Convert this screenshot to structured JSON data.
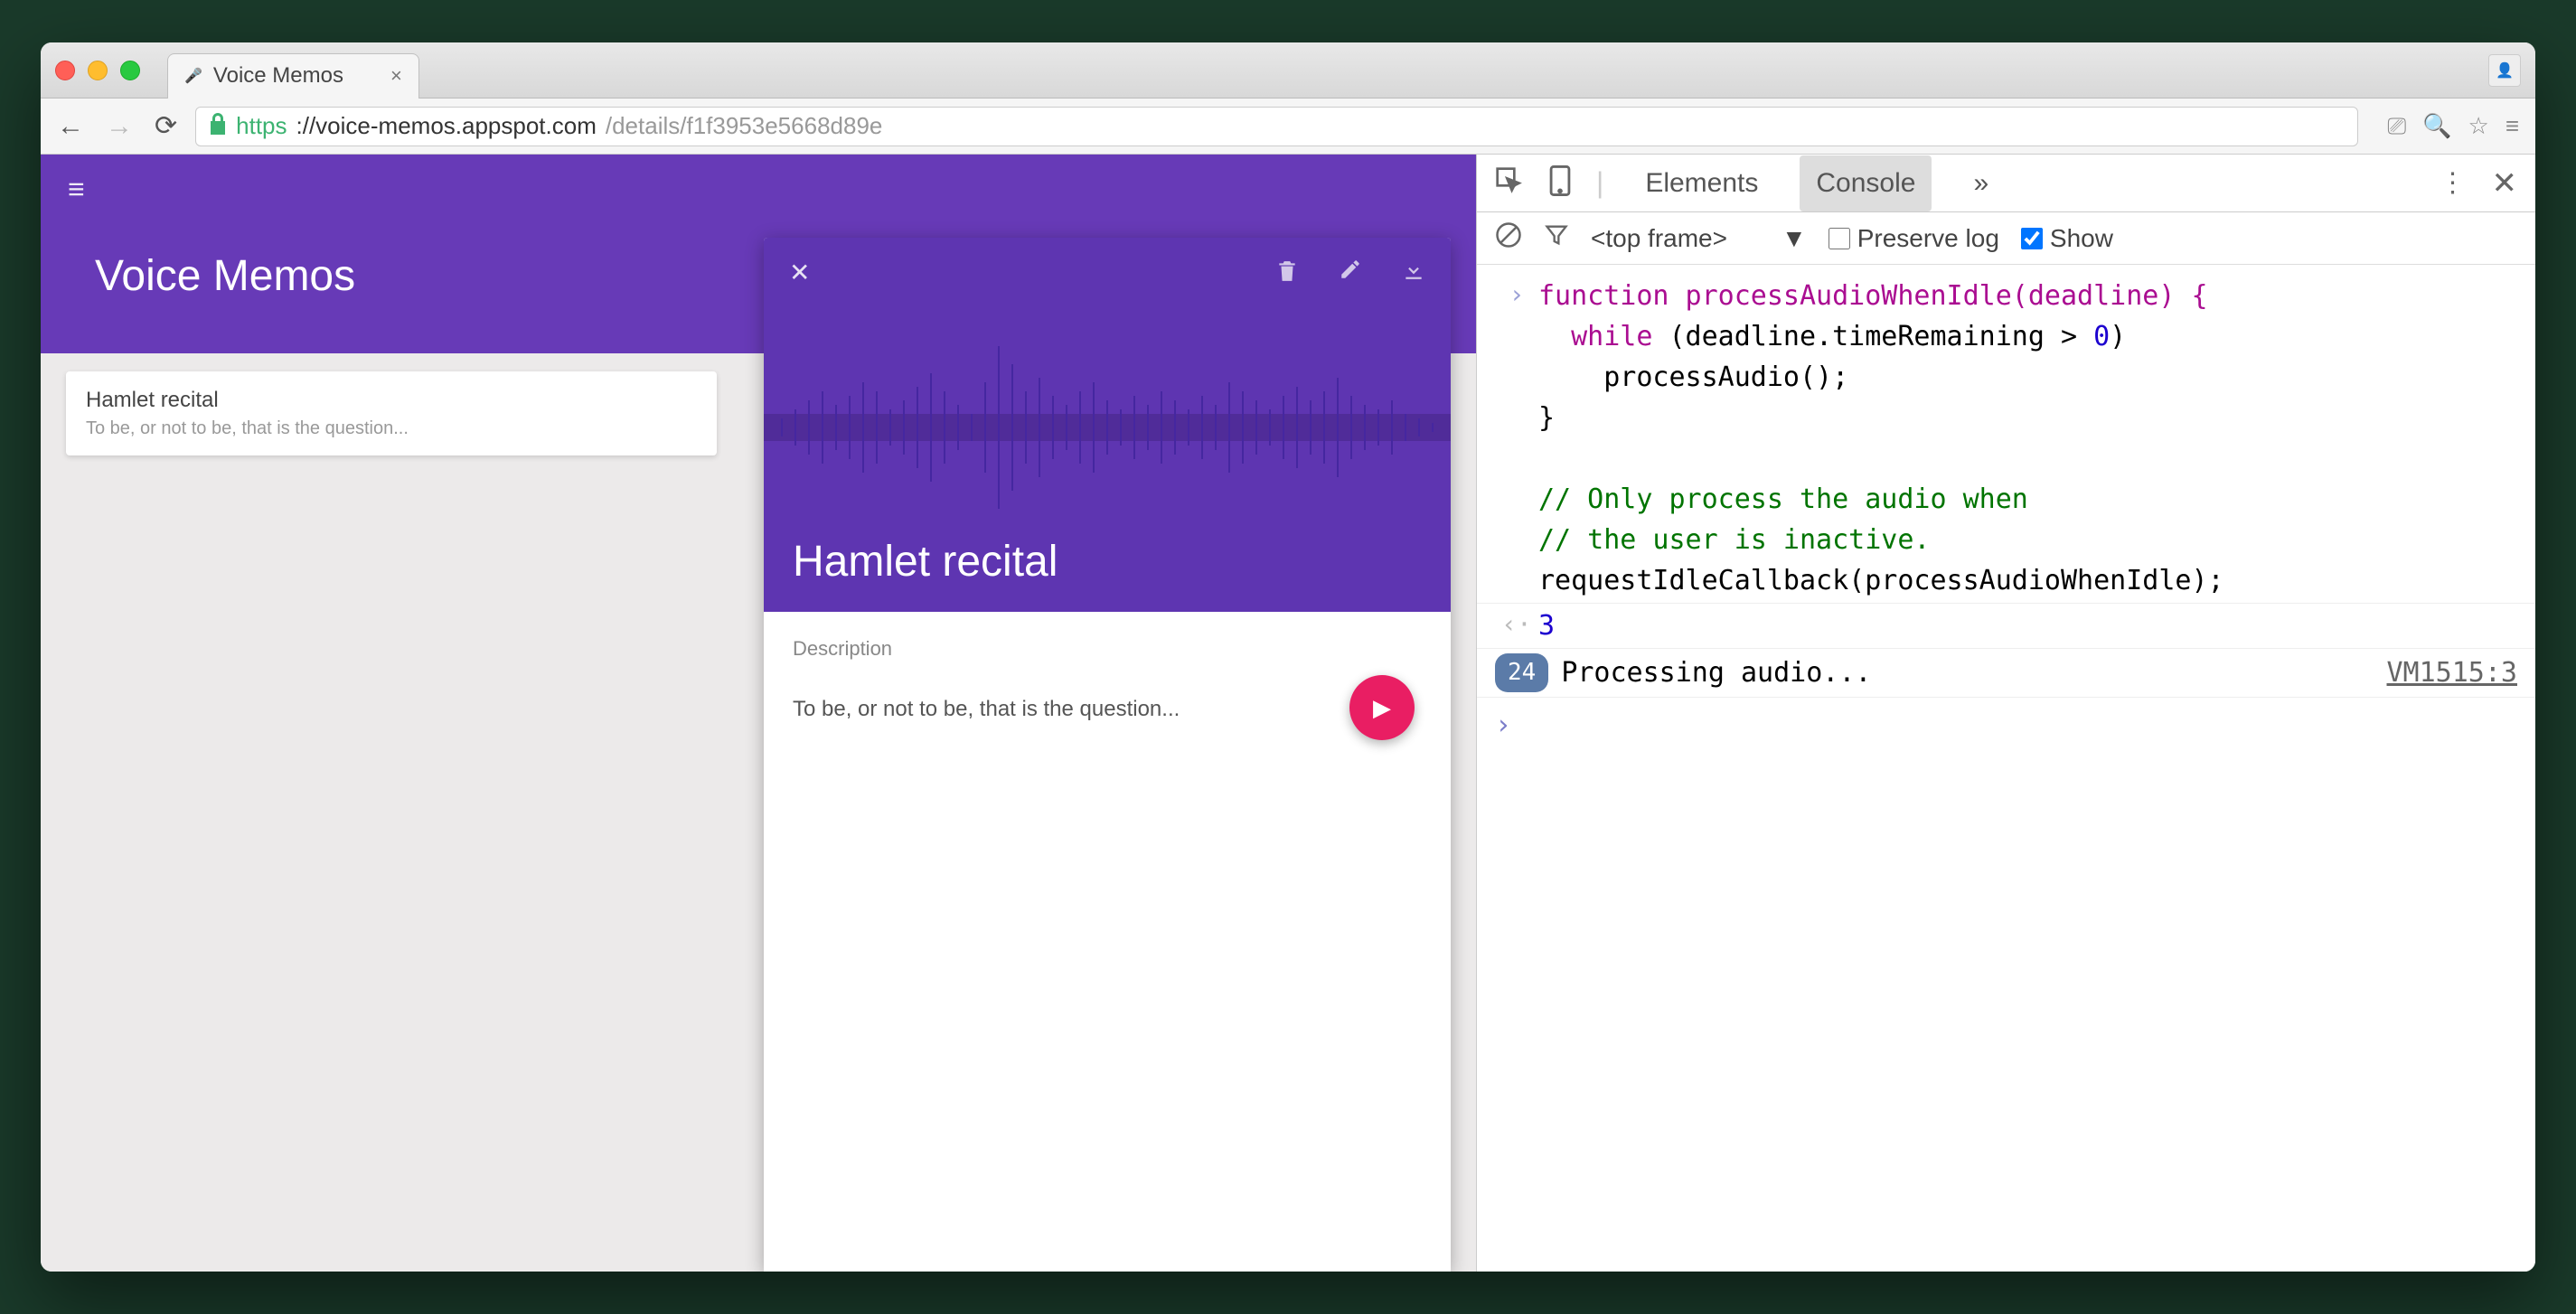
{
  "browser": {
    "tab_title": "Voice Memos",
    "url_scheme": "https",
    "url_host": "://voice-memos.appspot.com",
    "url_path": "/details/f1f3953e5668d89e"
  },
  "app": {
    "title": "Voice Memos",
    "list_item": {
      "title": "Hamlet recital",
      "subtitle": "To be, or not to be, that is the question..."
    },
    "detail": {
      "title": "Hamlet recital",
      "description_label": "Description",
      "description_text": "To be, or not to be, that is the question..."
    }
  },
  "devtools": {
    "tabs": {
      "elements": "Elements",
      "console": "Console",
      "more": "»"
    },
    "frame_selector": "<top frame>",
    "preserve_log_label": "Preserve log",
    "show_label": "Show",
    "code_lines": [
      "function processAudioWhenIdle(deadline) {",
      "  while (deadline.timeRemaining > 0)",
      "    processAudio();",
      "}",
      "",
      "// Only process the audio when",
      "// the user is inactive.",
      "requestIdleCallback(processAudioWhenIdle);"
    ],
    "return_value": "3",
    "log": {
      "count": "24",
      "message": "Processing audio...",
      "source": "VM1515:3"
    }
  }
}
